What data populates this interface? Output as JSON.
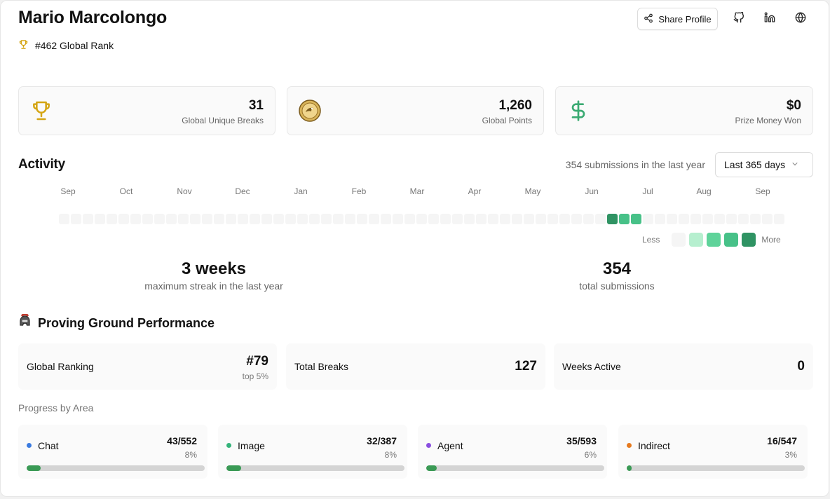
{
  "profile": {
    "name": "Mario Marcolongo",
    "rank_text": "#462 Global Rank"
  },
  "header": {
    "share_label": "Share Profile",
    "socials": [
      "github-icon",
      "linkedin-icon",
      "globe-icon"
    ]
  },
  "stats": [
    {
      "icon": "trophy-icon",
      "value": "31",
      "label": "Global Unique Breaks"
    },
    {
      "icon": "coin-icon",
      "value": "1,260",
      "label": "Global Points"
    },
    {
      "icon": "dollar-icon",
      "value": "$0",
      "label": "Prize Money Won"
    }
  ],
  "activity": {
    "title": "Activity",
    "submissions_text": "354 submissions in the last year",
    "range_selected": "Last 365 days",
    "months": [
      "Sep",
      "Oct",
      "Nov",
      "Dec",
      "Jan",
      "Feb",
      "Mar",
      "Apr",
      "May",
      "Jun",
      "Jul",
      "Aug",
      "Sep"
    ],
    "week_levels": [
      0,
      0,
      0,
      0,
      0,
      0,
      0,
      0,
      0,
      0,
      0,
      0,
      0,
      0,
      0,
      0,
      0,
      0,
      0,
      0,
      0,
      0,
      0,
      0,
      0,
      0,
      0,
      0,
      0,
      0,
      0,
      0,
      0,
      0,
      0,
      0,
      0,
      0,
      0,
      0,
      0,
      0,
      0,
      0,
      0,
      0,
      4,
      3,
      3,
      0,
      0,
      0,
      0,
      0,
      0,
      0,
      0,
      0,
      0,
      0,
      0
    ],
    "legend_less": "Less",
    "legend_more": "More",
    "level_colors": [
      "#f5f5f5",
      "#b6efcf",
      "#5fd39a",
      "#47c188",
      "#2f9363"
    ]
  },
  "summary": {
    "streak_value": "3 weeks",
    "streak_label": "maximum streak in the last year",
    "total_value": "354",
    "total_label": "total submissions"
  },
  "proving_ground": {
    "title": "Proving Ground Performance",
    "cards": [
      {
        "label": "Global Ranking",
        "value": "#79",
        "sub": "top 5%"
      },
      {
        "label": "Total Breaks",
        "value": "127"
      },
      {
        "label": "Weeks Active",
        "value": "0"
      }
    ]
  },
  "progress": {
    "title": "Progress by Area",
    "areas": [
      {
        "label": "Chat",
        "fraction": "43/552",
        "percent": "8%",
        "value": 0.078,
        "color": "#3b7be0"
      },
      {
        "label": "Image",
        "fraction": "32/387",
        "percent": "8%",
        "value": 0.083,
        "color": "#34b37a"
      },
      {
        "label": "Agent",
        "fraction": "35/593",
        "percent": "6%",
        "value": 0.059,
        "color": "#8a4fe0"
      },
      {
        "label": "Indirect",
        "fraction": "16/547",
        "percent": "3%",
        "value": 0.029,
        "color": "#e67a1f"
      }
    ]
  }
}
